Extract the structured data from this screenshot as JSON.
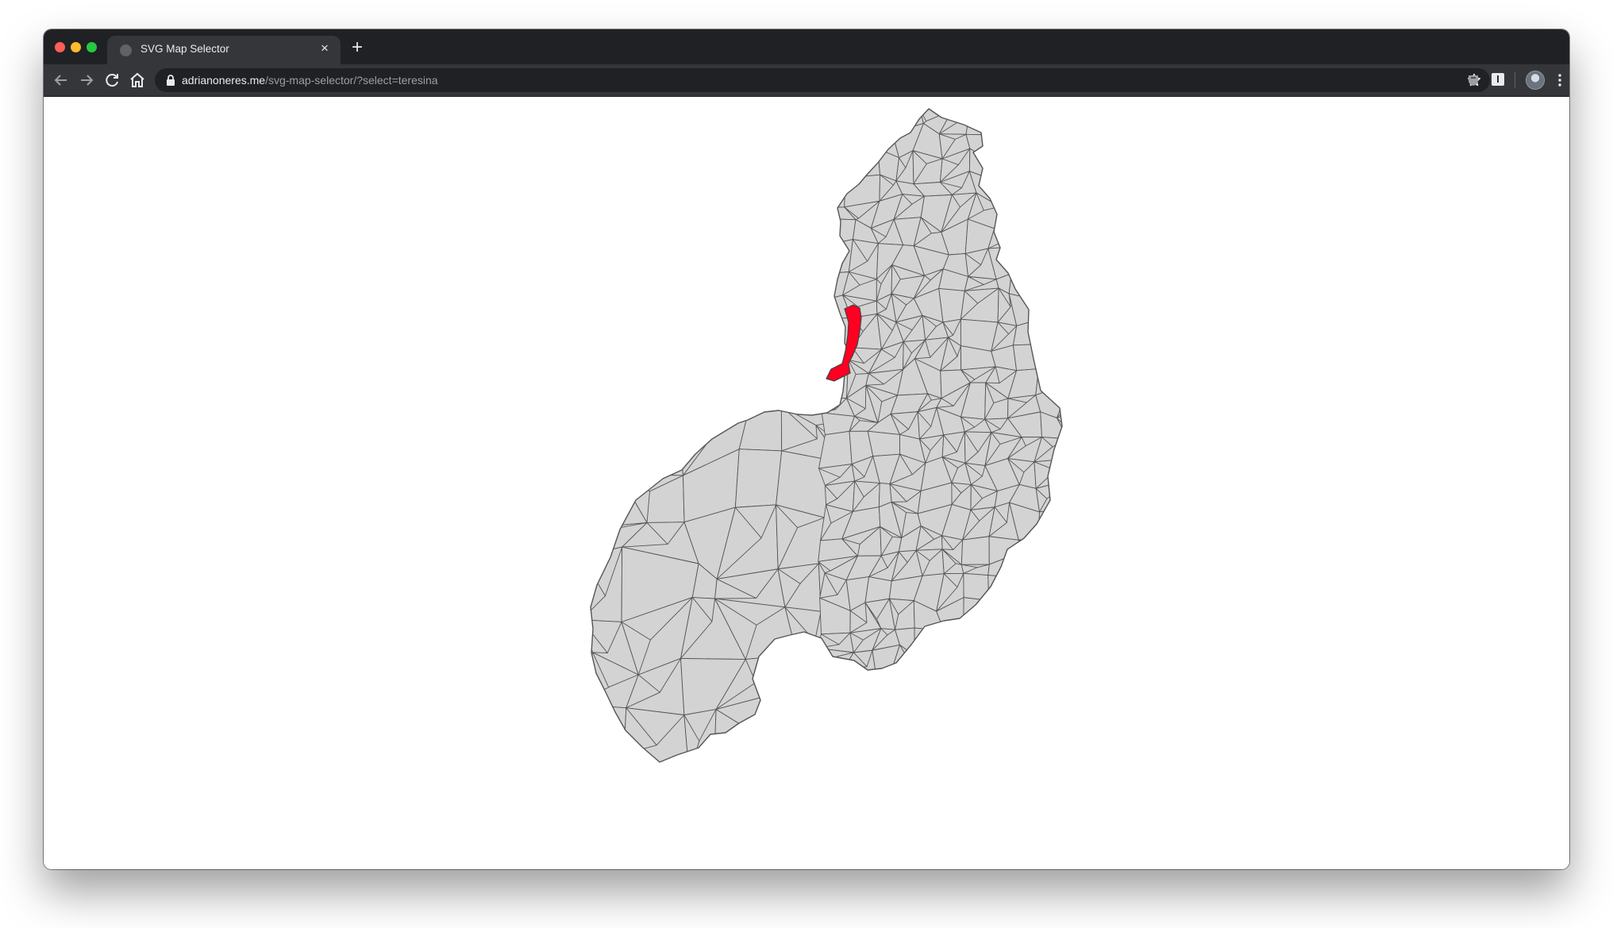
{
  "browser": {
    "tab_title": "SVG Map Selector",
    "tab_close_glyph": "×",
    "new_tab_glyph": "+",
    "url_host": "adrianoneres.me",
    "url_path": "/svg-map-selector/?select=teresina",
    "ext_label": "I",
    "icons": [
      "back-arrow-icon",
      "forward-arrow-icon",
      "reload-icon",
      "home-icon",
      "lock-icon",
      "star-icon",
      "extension-icon",
      "profile-avatar",
      "more-vert-icon"
    ]
  },
  "map": {
    "selected_region": "teresina",
    "colors": {
      "region_fill": "#d3d3d3",
      "region_stroke": "#555555",
      "selected_fill": "#ff0022",
      "selected_stroke": "#444444"
    }
  }
}
